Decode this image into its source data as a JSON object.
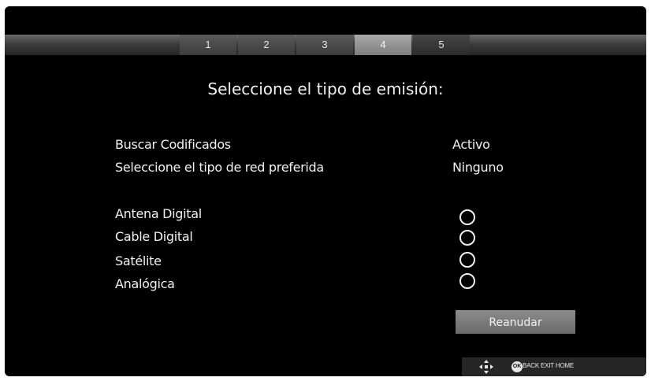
{
  "steps": [
    "1",
    "2",
    "3",
    "4",
    "5"
  ],
  "active_step": "4",
  "title": "Seleccione el tipo de emisión:",
  "settings": [
    {
      "label": "Buscar Codificados",
      "value": "Activo"
    },
    {
      "label": "Seleccione el tipo de red preferida",
      "value": "Ninguno"
    }
  ],
  "options": [
    {
      "label": "Antena Digital",
      "selected": false
    },
    {
      "label": "Cable Digital",
      "selected": false
    },
    {
      "label": "Satélite",
      "selected": false
    },
    {
      "label": "Analógica",
      "selected": false
    }
  ],
  "resume_button": "Reanudar",
  "nav": {
    "dpad_icon": "dpad-arrows-icon",
    "ok_label": "OK",
    "hint": "BACK EXIT HOME"
  }
}
